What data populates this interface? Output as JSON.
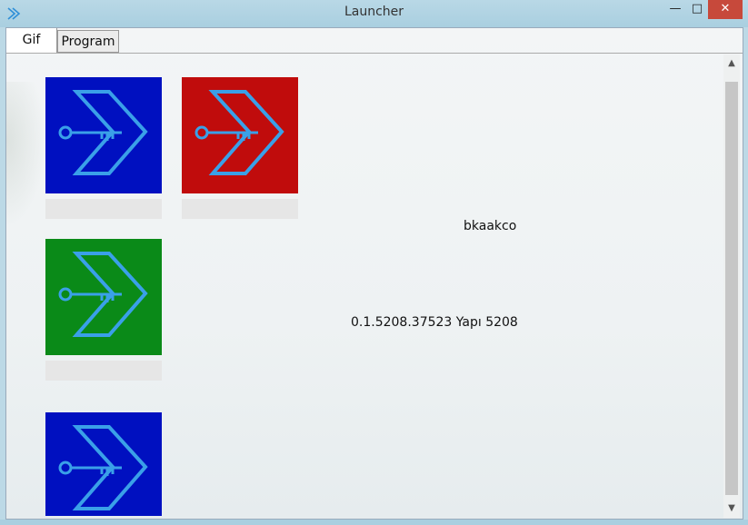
{
  "window": {
    "title": "Launcher",
    "minimize_glyph": "—",
    "maximize_glyph": "□",
    "close_glyph": "✕"
  },
  "tabs": [
    {
      "label": "Gif",
      "selected": true
    },
    {
      "label": "Program",
      "selected": false
    }
  ],
  "tiles": [
    {
      "color": "#0010c0",
      "icon": "key-arrow-icon"
    },
    {
      "color": "#c00c0c",
      "icon": "key-arrow-icon"
    },
    {
      "color": "#0a8a18",
      "icon": "key-arrow-icon"
    },
    {
      "color": "#0010c0",
      "icon": "key-arrow-icon"
    }
  ],
  "info": {
    "name": "bkaakco",
    "version": "0.1.5208.37523   Yapı 5208"
  },
  "colors": {
    "icon_stroke": "#3aa0e8",
    "close_button": "#c7493b"
  }
}
